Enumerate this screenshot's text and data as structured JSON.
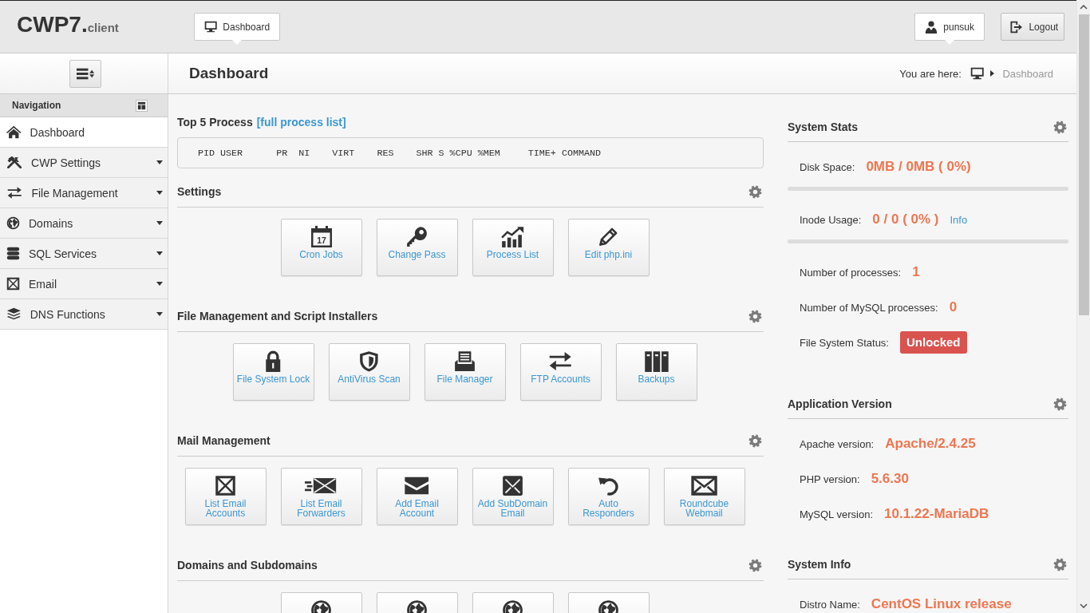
{
  "header": {
    "logo": {
      "title": "CWP7.",
      "suffix": "client"
    },
    "nav": [
      {
        "label": "Dashboard"
      }
    ],
    "user": {
      "name": "punsuk"
    },
    "logout": {
      "label": "Logout"
    }
  },
  "sidebar": {
    "nav_title": "Navigation",
    "items": [
      {
        "label": "Dashboard",
        "selected": true,
        "has_submenu": false
      },
      {
        "label": "CWP Settings",
        "selected": false,
        "has_submenu": true
      },
      {
        "label": "File Management",
        "selected": false,
        "has_submenu": true
      },
      {
        "label": "Domains",
        "selected": false,
        "has_submenu": true
      },
      {
        "label": "SQL Services",
        "selected": false,
        "has_submenu": true
      },
      {
        "label": "Email",
        "selected": false,
        "has_submenu": true
      },
      {
        "label": "DNS Functions",
        "selected": false,
        "has_submenu": true
      }
    ]
  },
  "page": {
    "title": "Dashboard",
    "breadcrumb": {
      "prefix": "You are here:",
      "current": "Dashboard"
    }
  },
  "processes": {
    "title": "Top 5 Process",
    "link": "[full process list]",
    "header_line": "PID USER      PR  NI    VIRT    RES    SHR S %CPU %MEM     TIME+ COMMAND"
  },
  "sections": [
    {
      "title": "Settings",
      "tiles": [
        {
          "label": "Cron Jobs",
          "calendar_day": "17"
        },
        {
          "label": "Change Pass"
        },
        {
          "label": "Process List"
        },
        {
          "label": "Edit php.ini"
        }
      ]
    },
    {
      "title": "File Management and Script Installers",
      "tiles": [
        {
          "label": "File System Lock"
        },
        {
          "label": "AntiVirus Scan"
        },
        {
          "label": "File Manager"
        },
        {
          "label": "FTP Accounts"
        },
        {
          "label": "Backups"
        }
      ]
    },
    {
      "title": "Mail Management",
      "tiles": [
        {
          "label": "List Email Accounts"
        },
        {
          "label": "List Email Forwarders"
        },
        {
          "label": "Add Email Account"
        },
        {
          "label": "Add SubDomain Email"
        },
        {
          "label": "Auto Responders"
        },
        {
          "label": "Roundcube Webmail"
        }
      ]
    },
    {
      "title": "Domains and Subdomains",
      "tiles": [
        {
          "kind": "icon_only"
        },
        {
          "kind": "icon_only"
        },
        {
          "kind": "icon_only"
        },
        {
          "kind": "icon_only"
        }
      ]
    }
  ],
  "side_panels": [
    {
      "title": "System Stats",
      "rows": [
        {
          "kind": "value",
          "label": "Disk Space:",
          "value": "0MB / 0MB ( 0%)",
          "level": 0
        },
        {
          "kind": "value",
          "label": "Inode Usage:",
          "value": "0 / 0 ( 0% )",
          "link": "Info",
          "level": 0
        },
        {
          "kind": "value",
          "label": "Number of processes:",
          "value": "1"
        },
        {
          "kind": "value",
          "label": "Number of MySQL processes:",
          "value": "0"
        },
        {
          "kind": "badge",
          "label": "File System Status:",
          "value": "Unlocked"
        }
      ]
    },
    {
      "title": "Application Version",
      "rows": [
        {
          "kind": "value",
          "label": "Apache version:",
          "value": "Apache/2.4.25"
        },
        {
          "kind": "value",
          "label": "PHP version:",
          "value": "5.6.30"
        },
        {
          "kind": "value",
          "label": "MySQL version:",
          "value": "10.1.22-MariaDB"
        }
      ]
    },
    {
      "title": "System Info",
      "rows": [
        {
          "kind": "value",
          "label": "Distro Name:",
          "value": "CentOS Linux release"
        }
      ]
    }
  ]
}
